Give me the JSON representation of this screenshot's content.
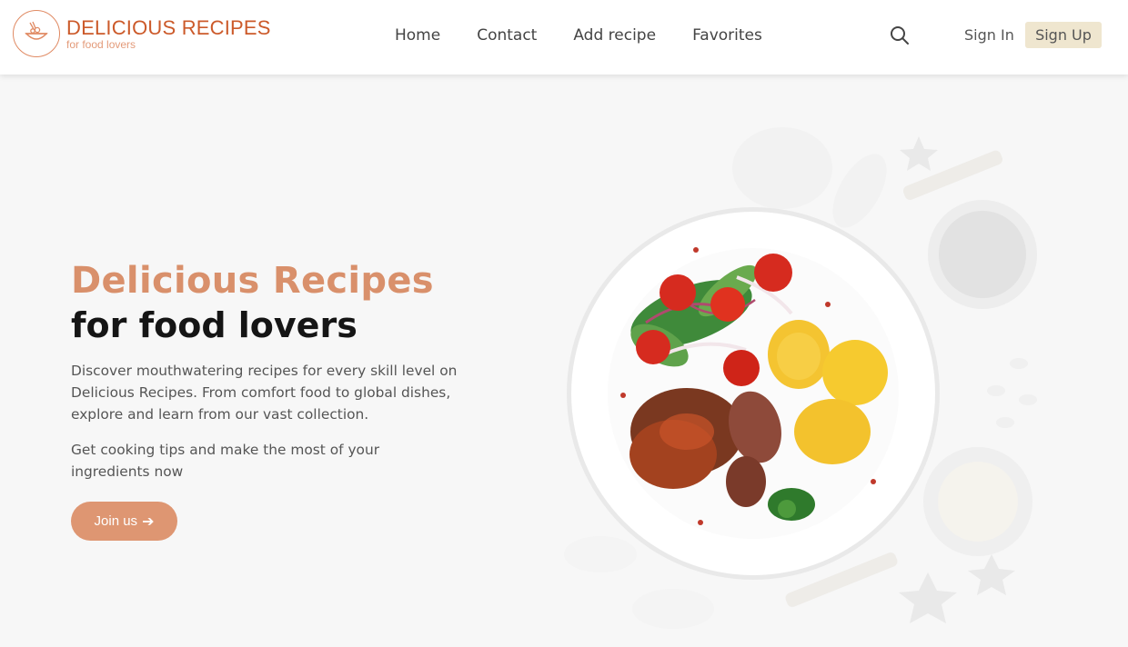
{
  "brand": {
    "title": "DELICIOUS RECIPES",
    "subtitle": "for food lovers",
    "accent": "#cc5a2a"
  },
  "nav": {
    "items": [
      "Home",
      "Contact",
      "Add recipe",
      "Favorites"
    ]
  },
  "auth": {
    "sign_in": "Sign In",
    "sign_up": "Sign Up"
  },
  "hero": {
    "title": "Delicious Recipes",
    "subtitle": "for food lovers",
    "paragraph1": "Discover mouthwatering recipes for every skill level on Delicious Recipes. From comfort food to global dishes, explore and learn from our vast collection.",
    "paragraph2": "Get cooking tips and make the most of your ingredients now",
    "cta": "Join us",
    "cta_color": "#de9672"
  },
  "icons": {
    "logo": "bowl-icon",
    "search": "search-icon",
    "cta_arrow": "arrow-right-icon"
  }
}
